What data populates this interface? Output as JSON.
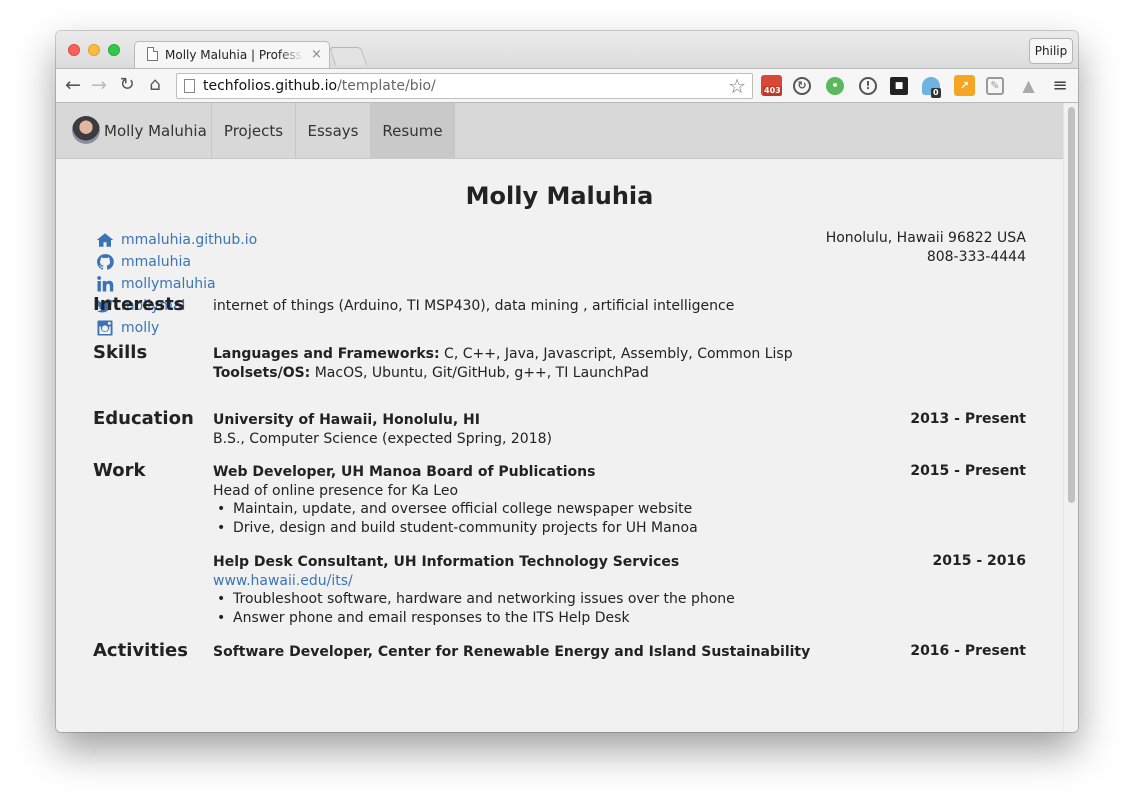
{
  "browser": {
    "tab_title": "Molly Maluhia | Professional Portfolio",
    "tab_close": "×",
    "profile_name": "Philip",
    "url_host": "techfolios.github.io",
    "url_path": "/template/bio/",
    "extension_badges": {
      "ext1": "403",
      "ext6": "0"
    }
  },
  "site_nav": {
    "brand": "Molly Maluhia",
    "items": [
      "Projects",
      "Essays",
      "Resume"
    ],
    "active": "Resume"
  },
  "resume": {
    "name": "Molly Maluhia",
    "contacts": [
      {
        "icon": "home-icon",
        "label": "mmaluhia.github.io"
      },
      {
        "icon": "github-icon",
        "label": "mmaluhia"
      },
      {
        "icon": "linkedin-icon",
        "label": "mollymaluhia"
      },
      {
        "icon": "twitter-icon",
        "label": "mollymal"
      },
      {
        "icon": "instagram-icon",
        "label": "molly"
      }
    ],
    "address": "Honolulu, Hawaii 96822 USA",
    "phone": "808-333-4444",
    "interests": {
      "heading": "Interests",
      "text": "internet of things (Arduino, TI MSP430), data mining , artificial intelligence"
    },
    "skills": {
      "heading": "Skills",
      "lang_label": "Languages and Frameworks:",
      "lang_value": " C, C++, Java, Javascript, Assembly, Common Lisp",
      "tools_label": "Toolsets/OS:",
      "tools_value": " MacOS, Ubuntu, Git/GitHub, g++, TI LaunchPad"
    },
    "education": {
      "heading": "Education",
      "school": "University of Hawaii, Honolulu, HI",
      "degree": "B.S., Computer Science (expected Spring, 2018)",
      "dates": "2013 - Present"
    },
    "work": {
      "heading": "Work",
      "jobs": [
        {
          "title": "Web Developer, UH Manoa Board of Publications",
          "dates": "2015 - Present",
          "summary": "Head of online presence for Ka Leo",
          "bullets": [
            "Maintain, update, and oversee official college newspaper website",
            "Drive, design and build student-community projects for UH Manoa"
          ]
        },
        {
          "title": "Help Desk Consultant, UH Information Technology Services",
          "dates": "2015 - 2016",
          "link": "www.hawaii.edu/its/",
          "bullets": [
            "Troubleshoot software, hardware and networking issues over the phone",
            "Answer phone and email responses to the ITS Help Desk"
          ]
        }
      ]
    },
    "activities": {
      "heading": "Activities",
      "title": "Software Developer, Center for Renewable Energy and Island Sustainability",
      "dates": "2016 - Present"
    }
  },
  "colors": {
    "link": "#3b74b5",
    "nav_bg": "#d8d8d8",
    "page_bg": "#f1f1f1"
  }
}
